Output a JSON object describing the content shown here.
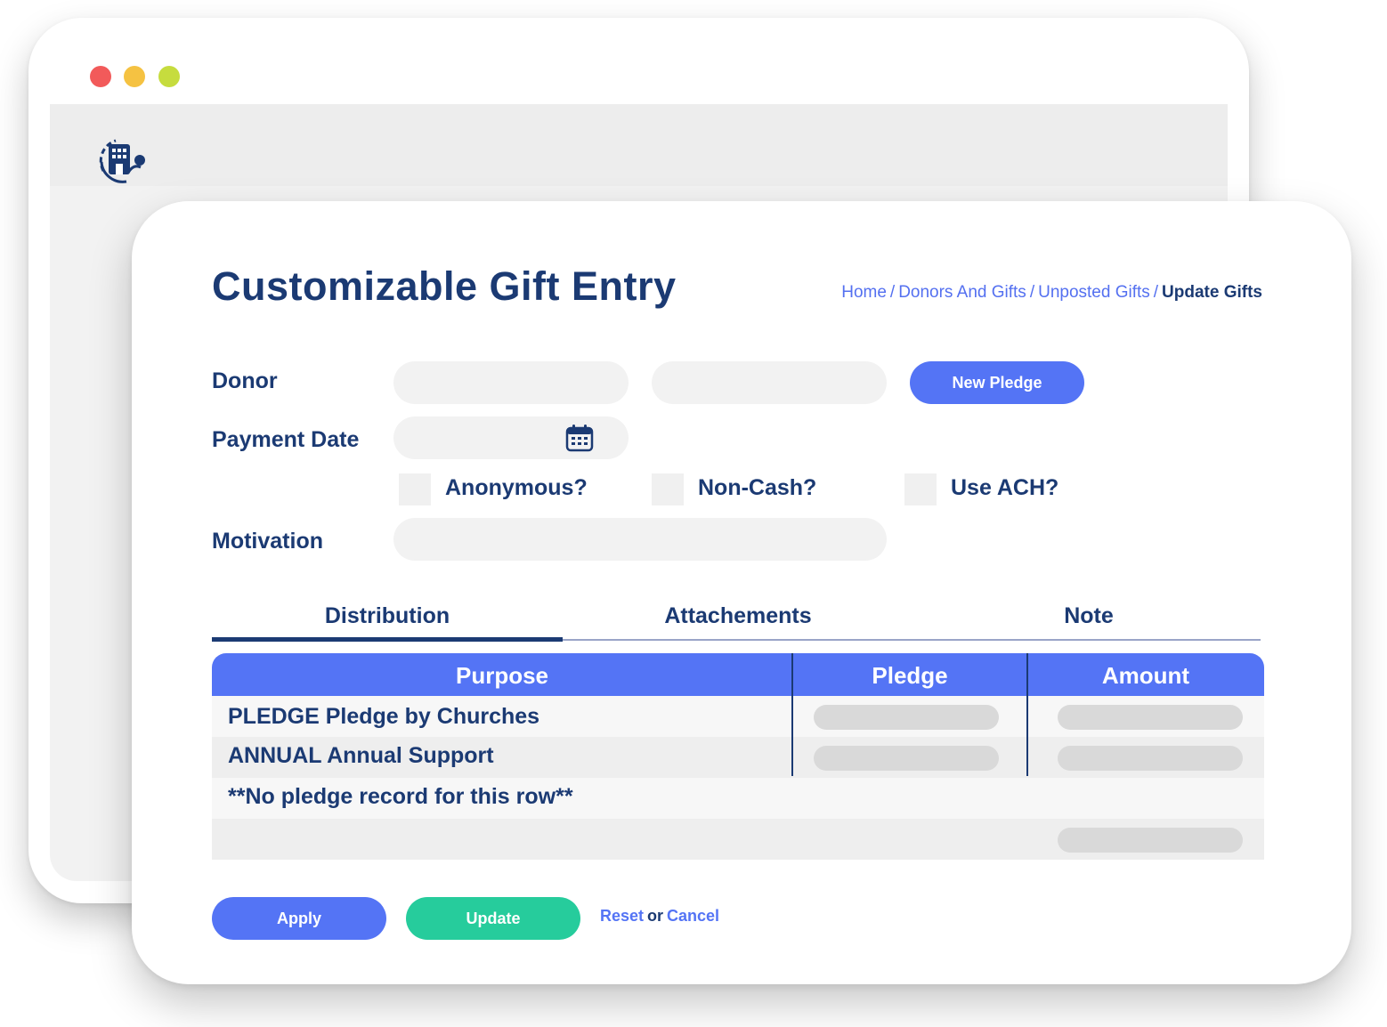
{
  "window": {
    "controls": [
      "close",
      "minimize",
      "maximize"
    ],
    "logo_icon": "building-heart-icon"
  },
  "page": {
    "title": "Customizable Gift Entry"
  },
  "breadcrumb": {
    "items": [
      "Home",
      "Donors And Gifts",
      "Unposted Gifts"
    ],
    "current": "Update Gifts",
    "separator": "/"
  },
  "form": {
    "donor_label": "Donor",
    "donor_field_1": "",
    "donor_field_2": "",
    "new_pledge_label": "New Pledge",
    "payment_date_label": "Payment Date",
    "payment_date_value": "",
    "calendar_icon": "calendar-icon",
    "anonymous_label": "Anonymous?",
    "noncash_label": "Non-Cash?",
    "ach_label": "Use ACH?",
    "motivation_label": "Motivation",
    "motivation_value": ""
  },
  "tabs": {
    "items": [
      "Distribution",
      "Attachements",
      "Note"
    ],
    "active": "Distribution"
  },
  "table": {
    "columns": [
      "Purpose",
      "Pledge",
      "Amount"
    ],
    "rows": [
      {
        "purpose": "PLEDGE Pledge by Churches"
      },
      {
        "purpose": "ANNUAL Annual Support"
      },
      {
        "purpose": "**No pledge record for this row**"
      }
    ]
  },
  "actions": {
    "apply_label": "Apply",
    "update_label": "Update",
    "reset_label": "Reset",
    "or_label": "or",
    "cancel_label": "Cancel"
  },
  "colors": {
    "primary": "#5474f5",
    "success": "#26cc9c",
    "text_dark": "#1b3a73",
    "field_bg": "#f2f2f2"
  }
}
